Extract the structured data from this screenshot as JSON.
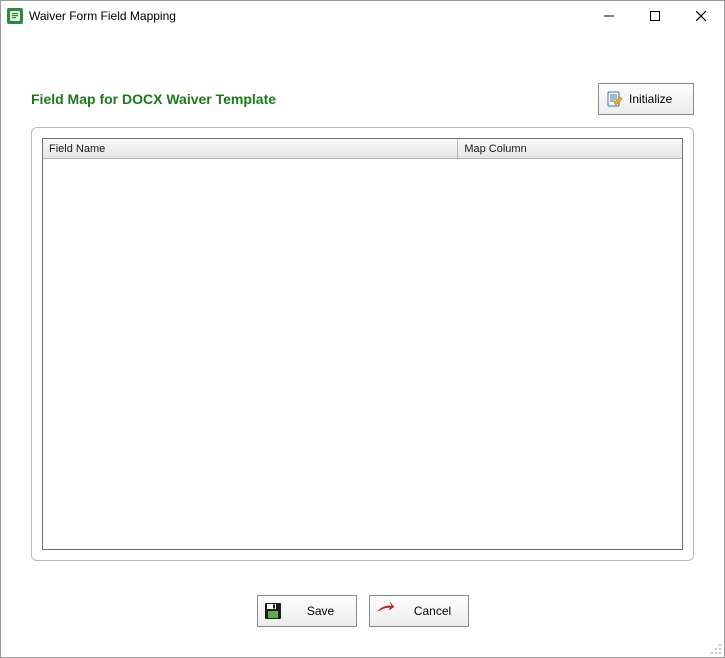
{
  "window": {
    "title": "Waiver Form Field Mapping"
  },
  "heading": "Field Map for DOCX Waiver Template",
  "buttons": {
    "initialize": "Initialize",
    "save": "Save",
    "cancel": "Cancel"
  },
  "grid": {
    "columns": [
      "Field Name",
      "Map Column"
    ],
    "rows": []
  },
  "colors": {
    "heading": "#1a7a1a"
  }
}
